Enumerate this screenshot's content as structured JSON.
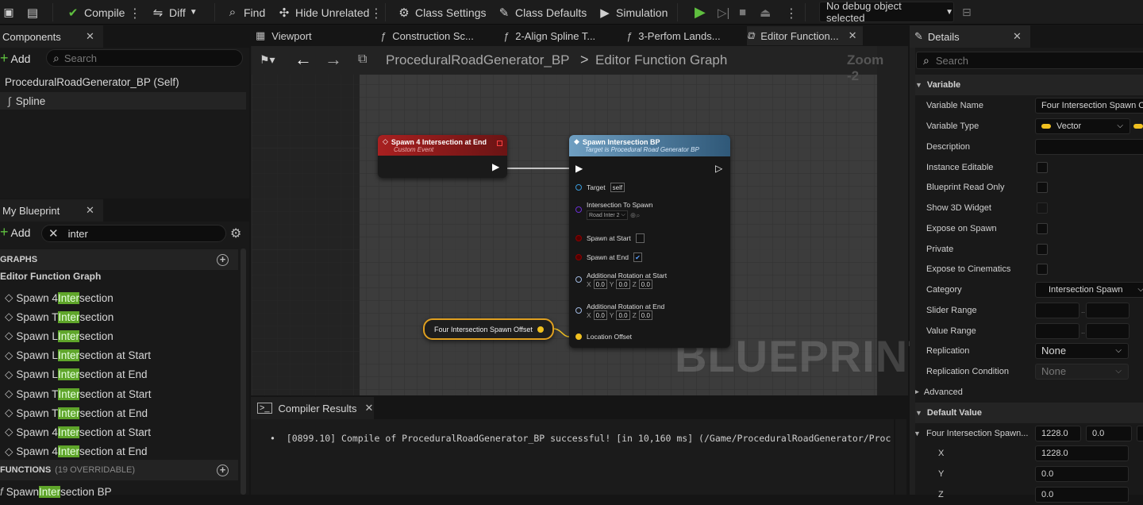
{
  "toolbar": {
    "compile": "Compile",
    "diff": "Diff",
    "find": "Find",
    "hide_unrelated": "Hide Unrelated",
    "class_settings": "Class Settings",
    "class_defaults": "Class Defaults",
    "simulation": "Simulation",
    "debug_object": "No debug object selected"
  },
  "components": {
    "tab": "Components",
    "add": "Add",
    "search_placeholder": "Search",
    "root": "ProceduralRoadGenerator_BP (Self)",
    "child": "Spline"
  },
  "my_blueprint": {
    "tab": "My Blueprint",
    "add": "Add",
    "search_value": "inter",
    "graphs_header": "GRAPHS",
    "graph_name": "Editor Function Graph",
    "items": [
      {
        "pre": "Spawn 4 ",
        "hl": "Inter",
        "post": "section"
      },
      {
        "pre": "Spawn T ",
        "hl": "Inter",
        "post": "section"
      },
      {
        "pre": "Spawn L ",
        "hl": "Inter",
        "post": "section"
      },
      {
        "pre": "Spawn L ",
        "hl": "Inter",
        "post": "section at Start"
      },
      {
        "pre": "Spawn L ",
        "hl": "Inter",
        "post": "section at End"
      },
      {
        "pre": "Spawn T ",
        "hl": "Inter",
        "post": "section at Start"
      },
      {
        "pre": "Spawn T ",
        "hl": "Inter",
        "post": "section at End"
      },
      {
        "pre": "Spawn 4 ",
        "hl": "Inter",
        "post": "section at Start"
      },
      {
        "pre": "Spawn 4 ",
        "hl": "Inter",
        "post": "section at End"
      }
    ],
    "functions_header": "FUNCTIONS",
    "functions_count": "(19 OVERRIDABLE)",
    "function_item": {
      "pre": "Spawn ",
      "hl": "Inter",
      "post": "section BP"
    }
  },
  "tabs": [
    {
      "label": "Viewport",
      "icon": "grid-icon"
    },
    {
      "label": "Construction Sc...",
      "icon": "function-icon"
    },
    {
      "label": "2-Align Spline T...",
      "icon": "function-icon"
    },
    {
      "label": "3-Perfom Lands...",
      "icon": "function-icon"
    },
    {
      "label": "Editor Function...",
      "icon": "graph-icon"
    }
  ],
  "breadcrumb": {
    "root": "ProceduralRoadGenerator_BP",
    "sep": ">",
    "current": "Editor Function Graph"
  },
  "zoom": "Zoom -2",
  "watermark": "BLUEPRINT",
  "event_node": {
    "title": "Spawn 4 Intersection at End",
    "subtitle": "Custom Event"
  },
  "call_node": {
    "title": "Spawn Intersection BP",
    "subtitle": "Target is Procedural Road Generator BP",
    "target_label": "Target",
    "target_value": "self",
    "intersection_label": "Intersection To Spawn",
    "intersection_value": "Road Inter 2",
    "spawn_start_label": "Spawn at Start",
    "spawn_end_label": "Spawn at End",
    "spawn_start_checked": false,
    "spawn_end_checked": true,
    "rot_start_label": "Additional Rotation at Start",
    "rot_end_label": "Additional Rotation at End",
    "axis_x": "X",
    "axis_y": "Y",
    "axis_z": "Z",
    "zero": "0.0",
    "location_label": "Location Offset"
  },
  "var_node": {
    "label": "Four Intersection Spawn Offset"
  },
  "compiler": {
    "tab": "Compiler Results",
    "message": "[0899.10] Compile of ProceduralRoadGenerator_BP successful! [in 10,160 ms] (/Game/ProceduralRoadGenerator/Proc"
  },
  "details": {
    "tab": "Details",
    "search_placeholder": "Search",
    "variable_header": "Variable",
    "variable_name_label": "Variable Name",
    "variable_name_value": "Four Intersection Spawn Off",
    "variable_type_label": "Variable Type",
    "variable_type_value": "Vector",
    "description_label": "Description",
    "instance_editable": "Instance Editable",
    "blueprint_read_only": "Blueprint Read Only",
    "show_3d_widget": "Show 3D Widget",
    "expose_on_spawn": "Expose on Spawn",
    "private": "Private",
    "expose_cinematics": "Expose to Cinematics",
    "category_label": "Category",
    "category_value": "Intersection Spawn",
    "slider_range": "Slider Range",
    "value_range": "Value Range",
    "range_dash": "..",
    "replication_label": "Replication",
    "replication_value": "None",
    "replication_condition_label": "Replication Condition",
    "replication_condition_value": "None",
    "advanced": "Advanced",
    "default_value_header": "Default Value",
    "default_row_label": "Four Intersection Spawn...",
    "default_x": "1228.0",
    "default_y": "0.0",
    "x_label": "X",
    "y_label": "Y",
    "z_label": "Z",
    "x_value": "1228.0",
    "y_value": "0.0",
    "z_value": "0.0"
  },
  "colors": {
    "accent_green": "#5fa52a",
    "vector_yellow": "#f0c020",
    "event_red": "#8c1c1c",
    "call_blue": "#2a5a7c"
  }
}
